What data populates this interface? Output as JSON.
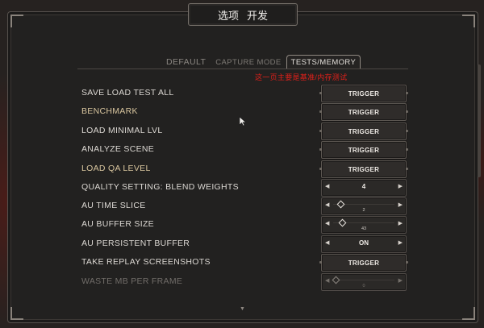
{
  "header": {
    "title_options": "选项",
    "title_dev": "开发"
  },
  "tabs": [
    {
      "label": "DEFAULT"
    },
    {
      "label": "CAPTURE MODE"
    },
    {
      "label": "TESTS/MEMORY"
    }
  ],
  "note": "这一页主要是基准/内存测试",
  "rows": [
    {
      "label": "SAVE LOAD TEST ALL",
      "control": "button",
      "value": "TRIGGER"
    },
    {
      "label": "BENCHMARK",
      "control": "button",
      "value": "TRIGGER"
    },
    {
      "label": "LOAD MINIMAL LVL",
      "control": "button",
      "value": "TRIGGER"
    },
    {
      "label": "ANALYZE SCENE",
      "control": "button",
      "value": "TRIGGER"
    },
    {
      "label": "LOAD QA LEVEL",
      "control": "button",
      "value": "TRIGGER"
    },
    {
      "label": "QUALITY SETTING: BLEND WEIGHTS",
      "control": "stepper",
      "value": "4"
    },
    {
      "label": "AU TIME SLICE",
      "control": "slider",
      "value": "2",
      "level": 0.08
    },
    {
      "label": "AU BUFFER SIZE",
      "control": "slider",
      "value": "43",
      "level": 0.12
    },
    {
      "label": "AU PERSISTENT BUFFER",
      "control": "stepper",
      "value": "ON"
    },
    {
      "label": "TAKE REPLAY SCREENSHOTS",
      "control": "button",
      "value": "TRIGGER"
    },
    {
      "label": "WASTE MB PER FRAME",
      "control": "slider",
      "value": "0",
      "level": 0.0
    }
  ],
  "icons": {
    "left_arrow": "◀",
    "right_arrow": "▶",
    "scroll_down": "▼"
  }
}
